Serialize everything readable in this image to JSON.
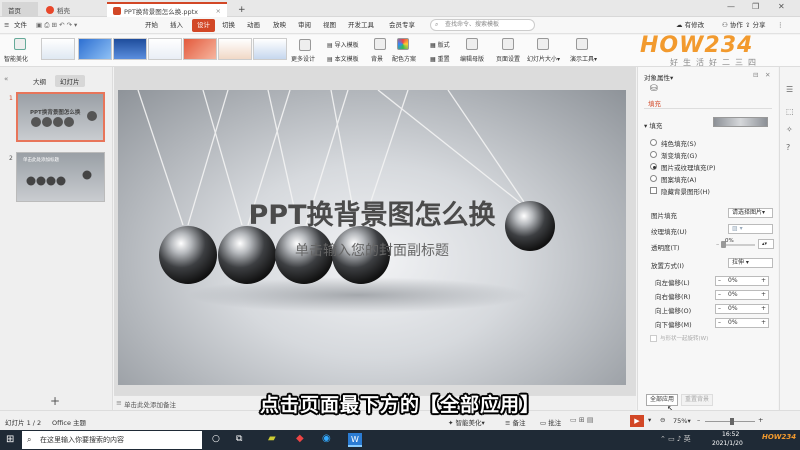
{
  "titlebar": {
    "tabs": [
      {
        "label": "首页"
      },
      {
        "label": "稻壳"
      },
      {
        "label": "PPT换背景图怎么换.pptx"
      }
    ]
  },
  "menubar": {
    "file": "文件",
    "items": [
      "开始",
      "插入",
      "设计",
      "切换",
      "动画",
      "放映",
      "审阅",
      "视图",
      "开发工具",
      "会员专享"
    ],
    "search_placeholder": "查找命令、搜索模板",
    "right": [
      "有修改",
      "协作",
      "分享"
    ]
  },
  "ribbon": {
    "smart_beautify": "智能美化",
    "more_design": "更多设计",
    "import_template": "导入模板",
    "this_doc_template": "本文模板",
    "background": "背景",
    "color_scheme": "配色方案",
    "layout": "版式",
    "reset": "重置",
    "edit_master": "编辑母版",
    "page_setup": "页面设置",
    "slide_size": "幻灯片大小",
    "presenter_tools": "演示工具"
  },
  "logo": {
    "big": "HOW234",
    "small": "好生活好二三四"
  },
  "left_panel": {
    "tabs": [
      "大纲",
      "幻灯片"
    ],
    "slides": [
      {
        "number": "1",
        "title": "PPT换背景图怎么换"
      },
      {
        "number": "2",
        "title": "单击此处添加标题"
      }
    ],
    "add": "+"
  },
  "slide": {
    "title": "PPT换背景图怎么换",
    "subtitle": "单击输入您的封面副标题"
  },
  "notes": {
    "placeholder": "单击此处添加备注"
  },
  "right_panel": {
    "header": "对象属性",
    "section": "填充",
    "fill_label": "填充",
    "options": [
      {
        "label": "纯色填充(S)",
        "checked": false
      },
      {
        "label": "渐变填充(G)",
        "checked": false
      },
      {
        "label": "图片或纹理填充(P)",
        "checked": true
      },
      {
        "label": "图案填充(A)",
        "checked": false
      }
    ],
    "hide_bg": "隐藏背景图形(H)",
    "picture_fill": "图片填充",
    "picture_fill_value": "请选择图片",
    "texture_fill": "纹理填充(U)",
    "transparency": "透明度(T)",
    "transparency_value": "0%",
    "placement": "放置方式(I)",
    "placement_value": "拉伸",
    "offsets": [
      {
        "label": "向左偏移(L)",
        "value": "0%"
      },
      {
        "label": "向右偏移(R)",
        "value": "0%"
      },
      {
        "label": "向上偏移(O)",
        "value": "0%"
      },
      {
        "label": "向下偏移(M)",
        "value": "0%"
      }
    ],
    "rotate_with_shape": "与形状一起旋转(W)",
    "apply_all": "全部应用",
    "reset_bg": "重置背景"
  },
  "statusbar": {
    "slide_info": "幻灯片 1 / 2",
    "theme": "Office 主题",
    "smart_beautify": "智能美化",
    "notes": "备注",
    "comment": "批注",
    "zoom": "75%"
  },
  "taskbar": {
    "search": "在这里输入你要搜索的内容",
    "time": "16:52",
    "date": "2021/1/20"
  },
  "caption": "点击页面最下方的【全部应用】"
}
